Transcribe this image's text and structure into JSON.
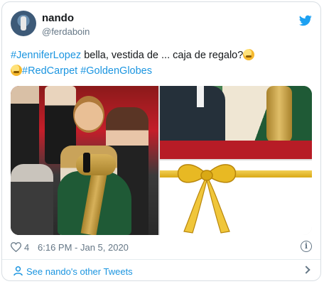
{
  "tweet": {
    "author_name": "nando",
    "author_handle": "@ferdaboin",
    "text_line1": {
      "hashtag": "#JenniferLopez",
      "rest": " bella, vestida de ... caja de regalo?"
    },
    "text_line2": {
      "hashtag1": "#RedCarpet",
      "hashtag2": "#GoldenGlobes"
    },
    "like_count": "4",
    "timestamp": "6:16 PM - Jan 5, 2020",
    "see_more_label": "See nando's other Tweets"
  },
  "icons": {
    "brand": "twitter-bird-icon",
    "like": "heart-icon",
    "info": "info-icon",
    "profile": "person-icon",
    "more": "chevron-right-icon",
    "emoji": "thinking-face-emoji",
    "emoji2": "shushing-face-emoji"
  },
  "colors": {
    "link": "#1b95e0",
    "text": "#14171a",
    "muted": "#657786",
    "twitter_blue": "#1da1f2",
    "ribbon_gold": "#e0b52a"
  }
}
